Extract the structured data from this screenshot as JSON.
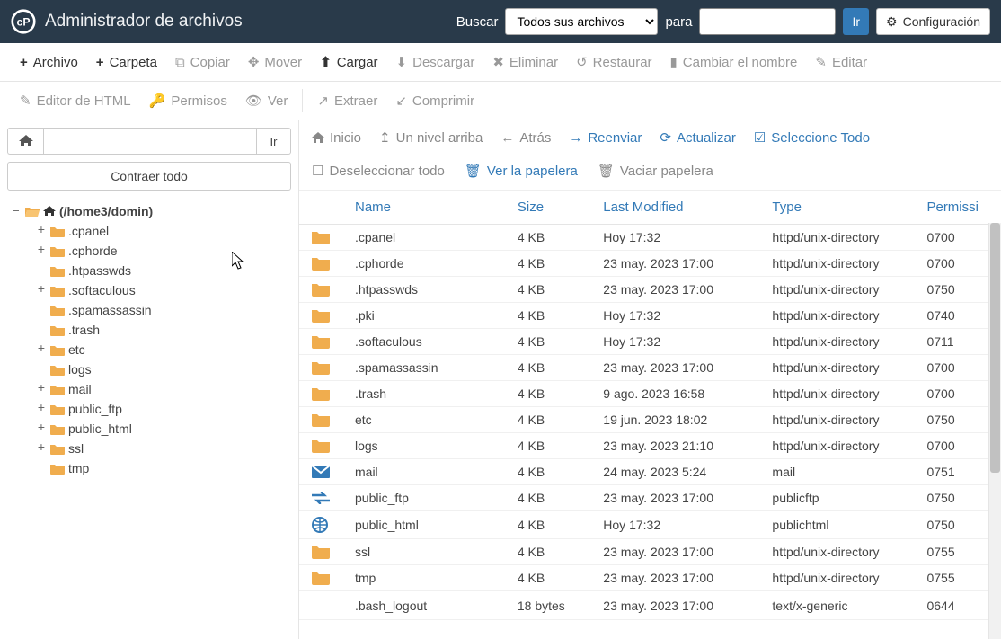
{
  "header": {
    "title": "Administrador de archivos",
    "search_label": "Buscar",
    "scope_selected": "Todos sus archivos",
    "for_label": "para",
    "go": "Ir",
    "config": "Configuración"
  },
  "toolbar_top": [
    {
      "key": "file",
      "icon": "plus",
      "label": "Archivo",
      "active": true
    },
    {
      "key": "folder",
      "icon": "plus",
      "label": "Carpeta",
      "active": true
    },
    {
      "key": "copy",
      "icon": "copy",
      "label": "Copiar",
      "active": false
    },
    {
      "key": "move",
      "icon": "move",
      "label": "Mover",
      "active": false
    },
    {
      "key": "upload",
      "icon": "upload",
      "label": "Cargar",
      "active": true
    },
    {
      "key": "download",
      "icon": "download",
      "label": "Descargar",
      "active": false
    },
    {
      "key": "delete",
      "icon": "delete",
      "label": "Eliminar",
      "active": false
    },
    {
      "key": "restore",
      "icon": "restore",
      "label": "Restaurar",
      "active": false
    },
    {
      "key": "rename",
      "icon": "rename",
      "label": "Cambiar el nombre",
      "active": false
    },
    {
      "key": "edit",
      "icon": "edit",
      "label": "Editar",
      "active": false
    }
  ],
  "toolbar_bottom": [
    {
      "key": "htmleditor",
      "icon": "edit",
      "label": "Editor de HTML",
      "active": false
    },
    {
      "key": "perms",
      "icon": "key",
      "label": "Permisos",
      "active": false
    },
    {
      "key": "view",
      "icon": "eye",
      "label": "Ver",
      "active": false
    },
    {
      "key": "sep",
      "sep": true
    },
    {
      "key": "extract",
      "icon": "extract",
      "label": "Extraer",
      "active": false
    },
    {
      "key": "compress",
      "icon": "compress",
      "label": "Comprimir",
      "active": false
    }
  ],
  "left": {
    "go": "Ir",
    "collapse_all": "Contraer todo",
    "root_label": "(/home3/domin)",
    "tree": [
      {
        "label": ".cpanel",
        "depth": 1,
        "expander": "+"
      },
      {
        "label": ".cphorde",
        "depth": 1,
        "expander": "+"
      },
      {
        "label": ".htpasswds",
        "depth": 1,
        "expander": ""
      },
      {
        "label": ".softaculous",
        "depth": 1,
        "expander": "+"
      },
      {
        "label": ".spamassassin",
        "depth": 1,
        "expander": ""
      },
      {
        "label": ".trash",
        "depth": 1,
        "expander": ""
      },
      {
        "label": "etc",
        "depth": 1,
        "expander": "+"
      },
      {
        "label": "logs",
        "depth": 1,
        "expander": ""
      },
      {
        "label": "mail",
        "depth": 1,
        "expander": "+"
      },
      {
        "label": "public_ftp",
        "depth": 1,
        "expander": "+"
      },
      {
        "label": "public_html",
        "depth": 1,
        "expander": "+"
      },
      {
        "label": "ssl",
        "depth": 1,
        "expander": "+"
      },
      {
        "label": "tmp",
        "depth": 1,
        "expander": ""
      }
    ]
  },
  "nav": {
    "home": "Inicio",
    "up": "Un nivel arriba",
    "back": "Atrás",
    "forward": "Reenviar",
    "refresh": "Actualizar",
    "select_all": "Seleccione Todo",
    "deselect_all": "Deseleccionar todo",
    "view_trash": "Ver la papelera",
    "empty_trash": "Vaciar papelera"
  },
  "columns": {
    "name": "Name",
    "size": "Size",
    "modified": "Last Modified",
    "type": "Type",
    "permissions": "Permissi"
  },
  "rows": [
    {
      "icon": "folder",
      "name": ".cpanel",
      "size": "4 KB",
      "modified": "Hoy 17:32",
      "type": "httpd/unix-directory",
      "perm": "0700"
    },
    {
      "icon": "folder",
      "name": ".cphorde",
      "size": "4 KB",
      "modified": "23 may. 2023 17:00",
      "type": "httpd/unix-directory",
      "perm": "0700"
    },
    {
      "icon": "folder",
      "name": ".htpasswds",
      "size": "4 KB",
      "modified": "23 may. 2023 17:00",
      "type": "httpd/unix-directory",
      "perm": "0750"
    },
    {
      "icon": "folder",
      "name": ".pki",
      "size": "4 KB",
      "modified": "Hoy 17:32",
      "type": "httpd/unix-directory",
      "perm": "0740"
    },
    {
      "icon": "folder",
      "name": ".softaculous",
      "size": "4 KB",
      "modified": "Hoy 17:32",
      "type": "httpd/unix-directory",
      "perm": "0711"
    },
    {
      "icon": "folder",
      "name": ".spamassassin",
      "size": "4 KB",
      "modified": "23 may. 2023 17:00",
      "type": "httpd/unix-directory",
      "perm": "0700"
    },
    {
      "icon": "folder",
      "name": ".trash",
      "size": "4 KB",
      "modified": "9 ago. 2023 16:58",
      "type": "httpd/unix-directory",
      "perm": "0700"
    },
    {
      "icon": "folder",
      "name": "etc",
      "size": "4 KB",
      "modified": "19 jun. 2023 18:02",
      "type": "httpd/unix-directory",
      "perm": "0750"
    },
    {
      "icon": "folder",
      "name": "logs",
      "size": "4 KB",
      "modified": "23 may. 2023 21:10",
      "type": "httpd/unix-directory",
      "perm": "0700"
    },
    {
      "icon": "mail",
      "name": "mail",
      "size": "4 KB",
      "modified": "24 may. 2023 5:24",
      "type": "mail",
      "perm": "0751"
    },
    {
      "icon": "swap",
      "name": "public_ftp",
      "size": "4 KB",
      "modified": "23 may. 2023 17:00",
      "type": "publicftp",
      "perm": "0750"
    },
    {
      "icon": "globe",
      "name": "public_html",
      "size": "4 KB",
      "modified": "Hoy 17:32",
      "type": "publichtml",
      "perm": "0750"
    },
    {
      "icon": "folder",
      "name": "ssl",
      "size": "4 KB",
      "modified": "23 may. 2023 17:00",
      "type": "httpd/unix-directory",
      "perm": "0755"
    },
    {
      "icon": "folder",
      "name": "tmp",
      "size": "4 KB",
      "modified": "23 may. 2023 17:00",
      "type": "httpd/unix-directory",
      "perm": "0755"
    },
    {
      "icon": "blank",
      "name": ".bash_logout",
      "size": "18 bytes",
      "modified": "23 may. 2023 17:00",
      "type": "text/x-generic",
      "perm": "0644"
    }
  ],
  "toolbar_icons": {
    "plus": "+",
    "copy": "⧉",
    "move": "✥",
    "upload": "⬆",
    "download": "⬇",
    "delete": "✖",
    "restore": "↺",
    "rename": "▮",
    "edit": "✎",
    "key": "🔑",
    "eye": "👁",
    "extract": "↗",
    "compress": "↙"
  },
  "nav_icons": {
    "home": "⌂",
    "up": "↑",
    "back": "←",
    "forward": "→",
    "refresh": "⟳",
    "check": "☑",
    "uncheck": "☐",
    "trash": "🗑"
  }
}
